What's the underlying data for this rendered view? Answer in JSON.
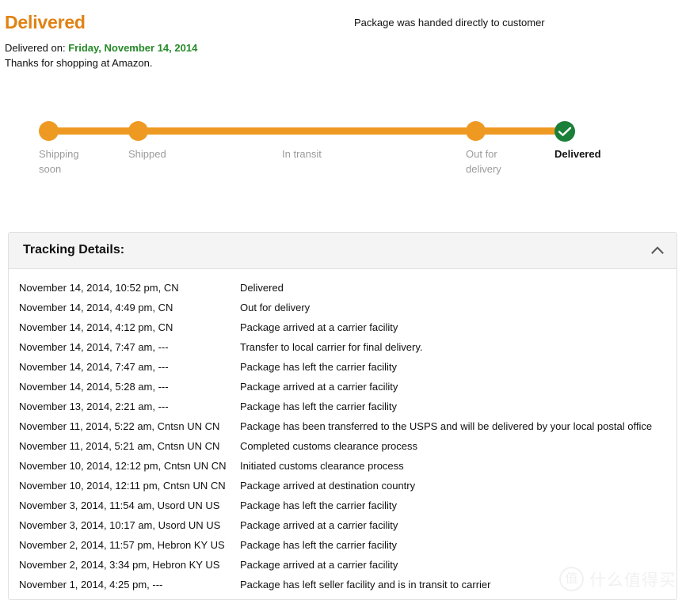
{
  "status": {
    "heading": "Delivered",
    "delivered_on_label": "Delivered on:",
    "delivered_on_date": "Friday, November 14, 2014",
    "thanks_line": "Thanks for shopping at Amazon.",
    "handoff_note": "Package was handed directly to customer",
    "heading_color": "#E08214",
    "date_color": "#268A28"
  },
  "tracker": {
    "bar_color": "#EE9A22",
    "done_color": "#1A7F39",
    "inactive_label_color": "#9B9B9B",
    "steps": [
      {
        "label": "Shipping soon",
        "dot": "orange",
        "current": false
      },
      {
        "label": "Shipped",
        "dot": "orange",
        "current": false
      },
      {
        "label": "In transit",
        "dot": "none",
        "current": false
      },
      {
        "label": "Out for delivery",
        "dot": "orange",
        "current": false
      },
      {
        "label": "Delivered",
        "dot": "green-check",
        "current": true
      }
    ]
  },
  "panel": {
    "title": "Tracking Details:",
    "collapse_icon": "chevron-up-icon",
    "rows": [
      {
        "date": "November 14, 2014, 10:52 pm,   CN",
        "status": "Delivered"
      },
      {
        "date": "November 14, 2014, 4:49 pm,   CN",
        "status": "Out for delivery"
      },
      {
        "date": "November 14, 2014, 4:12 pm,   CN",
        "status": "Package arrived at a carrier facility"
      },
      {
        "date": "November 14, 2014, 7:47 am, ---",
        "status": "Transfer to local carrier for final delivery."
      },
      {
        "date": "November 14, 2014, 7:47 am, ---",
        "status": "Package has left the carrier facility"
      },
      {
        "date": "November 14, 2014, 5:28 am, ---",
        "status": "Package arrived at a carrier facility"
      },
      {
        "date": "November 13, 2014, 2:21 am, ---",
        "status": "Package has left the carrier facility"
      },
      {
        "date": "November 11, 2014, 5:22 am, Cntsn UN CN",
        "status": "Package has been transferred to the USPS and will be delivered by your local postal office"
      },
      {
        "date": "November 11, 2014, 5:21 am, Cntsn UN CN",
        "status": "Completed customs clearance process"
      },
      {
        "date": "November 10, 2014, 12:12 pm, Cntsn UN CN",
        "status": "Initiated customs clearance process"
      },
      {
        "date": "November 10, 2014, 12:11 pm, Cntsn UN CN",
        "status": "Package arrived at destination country"
      },
      {
        "date": "November 3, 2014, 11:54 am, Usord UN US",
        "status": "Package has left the carrier facility"
      },
      {
        "date": "November 3, 2014, 10:17 am, Usord UN US",
        "status": "Package arrived at a carrier facility"
      },
      {
        "date": "November 2, 2014, 11:57 pm, Hebron KY US",
        "status": "Package has left the carrier facility"
      },
      {
        "date": "November 2, 2014, 3:34 pm, Hebron KY US",
        "status": "Package arrived at a carrier facility"
      },
      {
        "date": "November 1, 2014, 4:25 pm, ---",
        "status": "Package has left seller facility and is in transit to carrier"
      }
    ]
  },
  "watermark": {
    "mark": "值",
    "text": "什么值得买"
  }
}
